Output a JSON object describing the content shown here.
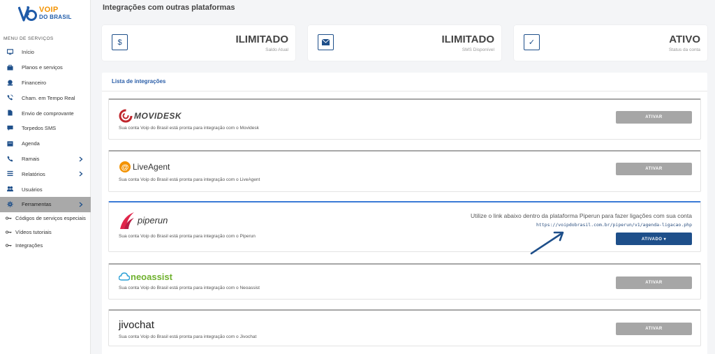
{
  "brand": {
    "line1": "VOIP",
    "line2": "DO BRASIL"
  },
  "sidebar": {
    "menu_title": "MENU DE SERVIÇOS",
    "items": [
      {
        "label": "Início",
        "icon": "monitor-icon"
      },
      {
        "label": "Planos e serviços",
        "icon": "bag-icon"
      },
      {
        "label": "Financeiro",
        "icon": "finance-icon"
      },
      {
        "label": "Cham. em Tempo Real",
        "icon": "phone-call-icon"
      },
      {
        "label": "Envio de comprovante",
        "icon": "file-icon"
      },
      {
        "label": "Torpedos SMS",
        "icon": "chat-icon"
      },
      {
        "label": "Agenda",
        "icon": "calendar-icon"
      },
      {
        "label": "Ramais",
        "icon": "phone-icon"
      },
      {
        "label": "Relatórios",
        "icon": "list-icon"
      },
      {
        "label": "Usuários",
        "icon": "users-icon"
      },
      {
        "label": "Ferramentas",
        "icon": "gear-icon"
      }
    ],
    "subitems": [
      {
        "label": "Códigos de serviços especiais"
      },
      {
        "label": "Vídeos tutoriais"
      },
      {
        "label": "Integrações"
      }
    ]
  },
  "page": {
    "title": "Integrações com outras plataformas"
  },
  "stats": [
    {
      "value": "ILIMITADO",
      "label": "Saldo Atual",
      "icon": "dollar-icon",
      "glyph": "$"
    },
    {
      "value": "ILIMITADO",
      "label": "SMS Disponível",
      "icon": "envelope-icon",
      "glyph": "✉"
    },
    {
      "value": "ATIVO",
      "label": "Status da conta",
      "icon": "check-icon",
      "glyph": "✓"
    }
  ],
  "list": {
    "title": "Lista de integrações"
  },
  "integrations": [
    {
      "name": "MOVIDESK",
      "desc": "Sua conta Voip do Brasil está pronta para integração com o Movidesk",
      "button": "ATIVAR"
    },
    {
      "name": "LiveAgent",
      "desc": "Sua conta Voip do Brasil está pronta para integração com o LiveAgent",
      "button": "ATIVAR"
    },
    {
      "name": "piperun",
      "desc": "Sua conta Voip do Brasil está pronta para integração com o Piperun",
      "button": "ATIVADO ▾",
      "info": "Utilize o link abaixo dentro da plataforma Piperun para fazer ligações com sua conta",
      "link": "https://voipdobrasil.com.br/piperun/v1/agenda-ligacao.php"
    },
    {
      "name": "neoassist",
      "desc": "Sua conta Voip do Brasil está pronta para integração com o Neoassist",
      "button": "ATIVAR"
    },
    {
      "name": "jivochat",
      "desc": "Sua conta Voip do Brasil está pronta para integração com o Jivochat",
      "button": "ATIVAR"
    }
  ],
  "colors": {
    "primary": "#1e4f8a",
    "disabled_button": "#a6a6a6",
    "accent_orange": "#f39200",
    "active_menu": "#a9a9a9"
  }
}
